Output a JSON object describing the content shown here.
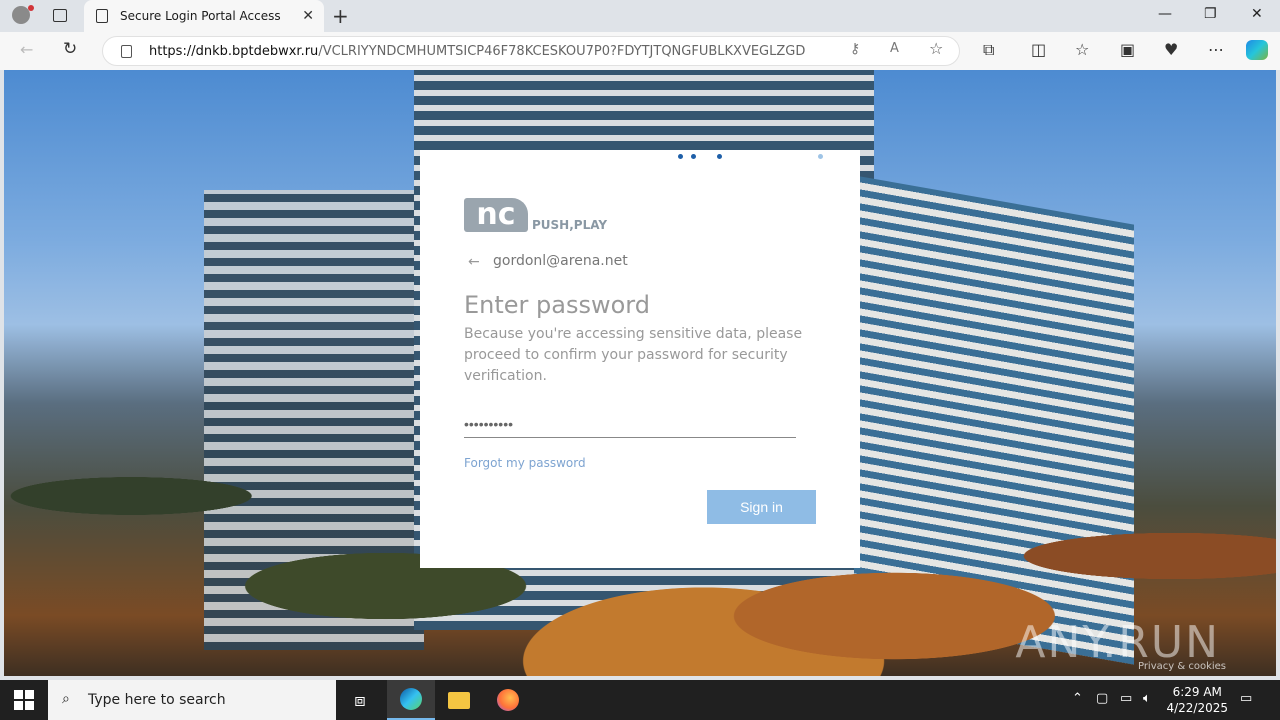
{
  "browser": {
    "tab_title": "Secure Login Portal Access",
    "tab_close": "✕",
    "new_tab": "+",
    "url_host": "https://dnkb.bptdebwxr.ru",
    "url_path": "/VCLRIYYNDCMHUMTSICP46F78KCESKOU7P0?FDYTJTQNGFUBLKXVEGLZGD",
    "icons": [
      "profile-icon",
      "tab-actions-icon",
      "back-icon",
      "refresh-icon",
      "lock-icon",
      "key-icon",
      "read-aloud-icon",
      "favorite-icon",
      "extensions-icon",
      "split-screen-icon",
      "favorites-icon",
      "collections-icon",
      "performance-icon",
      "more-icon",
      "copilot-icon"
    ]
  },
  "login": {
    "brand_mark": "nc",
    "brand_tag": "PUSH,PLAY",
    "back_arrow": "←",
    "email": "gordonl@arena.net",
    "title": "Enter password",
    "description": "Because you're accessing sensitive data, please proceed to confirm your password for security verification.",
    "password_value": "••••••••••",
    "forgot_link": "Forgot my password",
    "signin_button": "Sign in",
    "footer_privacy": "Privacy & cookies"
  },
  "watermark": "ANY.RUN",
  "taskbar": {
    "search_placeholder": "Type here to search",
    "time": "6:29 AM",
    "date": "4/22/2025"
  },
  "colors": {
    "accent_button": "#8fbce5",
    "link": "#7ea4d1",
    "taskbar": "#202020"
  }
}
